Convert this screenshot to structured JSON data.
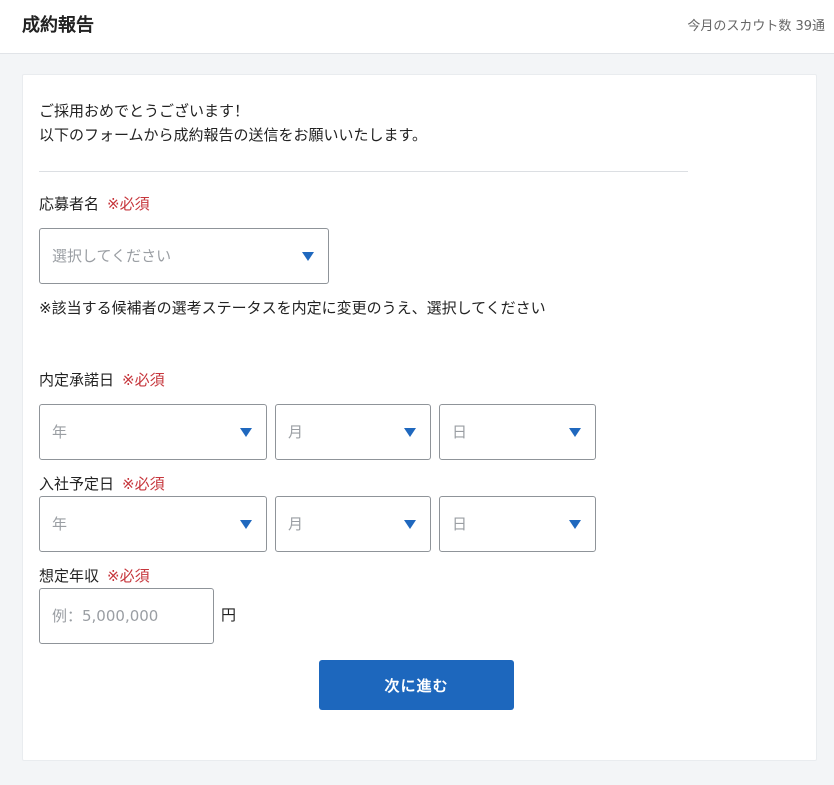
{
  "header": {
    "title": "成約報告",
    "scout_count": "今月のスカウト数 39通"
  },
  "form": {
    "intro_line1": "ご採用おめでとうございます！",
    "intro_line2": "以下のフォームから成約報告の送信をお願いいたします。",
    "required_mark": "※必須",
    "applicant": {
      "label": "応募者名",
      "placeholder": "選択してください",
      "note": "※該当する候補者の選考ステータスを内定に変更のうえ、選択してください"
    },
    "offer_date": {
      "label": "内定承諾日",
      "year": "年",
      "month": "月",
      "day": "日"
    },
    "join_date": {
      "label": "入社予定日",
      "year": "年",
      "month": "月",
      "day": "日"
    },
    "income": {
      "label": "想定年収",
      "placeholder": "例：5,000,000",
      "unit": "円"
    },
    "next_button": "次に進む"
  },
  "colors": {
    "accent": "#1d67bd",
    "required": "#c6363c"
  },
  "icons": {
    "dropdown": "caret-down-icon"
  }
}
